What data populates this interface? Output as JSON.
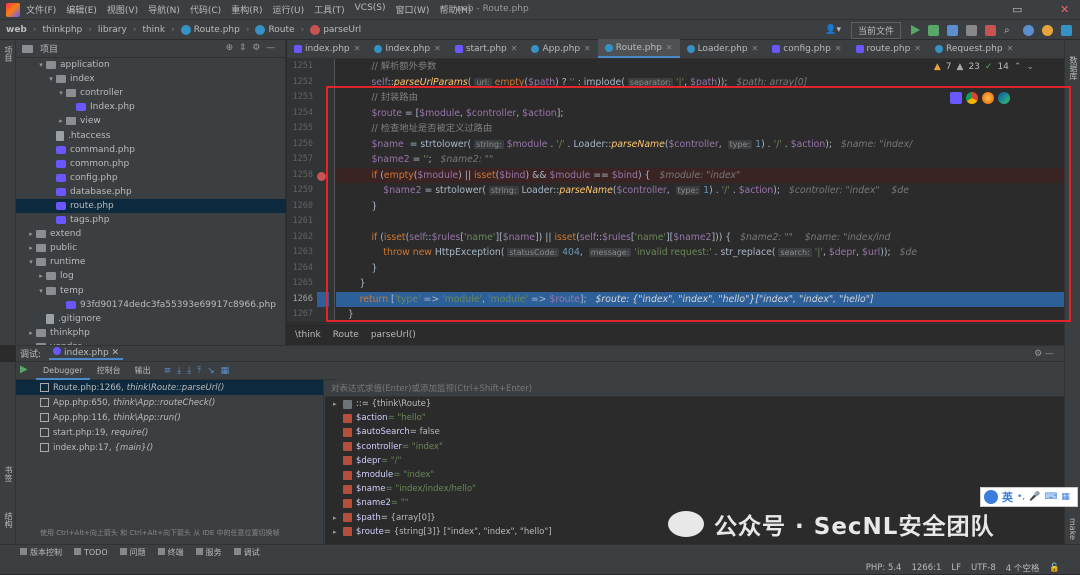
{
  "menubar": {
    "items": [
      "文件(F)",
      "编辑(E)",
      "视图(V)",
      "导航(N)",
      "代码(C)",
      "重构(R)",
      "运行(U)",
      "工具(T)",
      "VCS(S)",
      "窗口(W)",
      "帮助(H)"
    ],
    "title": "web - Route.php"
  },
  "navbar": {
    "crumbs": [
      "web",
      "thinkphp",
      "library",
      "think",
      "Route.php",
      "Route",
      "parseUrl"
    ],
    "run_config": "当前文件"
  },
  "project": {
    "header": "项目",
    "tree": [
      {
        "label": "application",
        "indent": 3,
        "arrow": "v",
        "icon": "folder"
      },
      {
        "label": "index",
        "indent": 4,
        "arrow": "v",
        "icon": "folder"
      },
      {
        "label": "controller",
        "indent": 5,
        "arrow": "v",
        "icon": "folder"
      },
      {
        "label": "Index.php",
        "indent": 6,
        "arrow": "",
        "icon": "php"
      },
      {
        "label": "view",
        "indent": 5,
        "arrow": ">",
        "icon": "folder"
      },
      {
        "label": ".htaccess",
        "indent": 4,
        "arrow": "",
        "icon": "file"
      },
      {
        "label": "command.php",
        "indent": 4,
        "arrow": "",
        "icon": "php"
      },
      {
        "label": "common.php",
        "indent": 4,
        "arrow": "",
        "icon": "php"
      },
      {
        "label": "config.php",
        "indent": 4,
        "arrow": "",
        "icon": "php"
      },
      {
        "label": "database.php",
        "indent": 4,
        "arrow": "",
        "icon": "php"
      },
      {
        "label": "route.php",
        "indent": 4,
        "arrow": "",
        "icon": "php",
        "selected": true
      },
      {
        "label": "tags.php",
        "indent": 4,
        "arrow": "",
        "icon": "php"
      },
      {
        "label": "extend",
        "indent": 2,
        "arrow": ">",
        "icon": "folder"
      },
      {
        "label": "public",
        "indent": 2,
        "arrow": ">",
        "icon": "folder"
      },
      {
        "label": "runtime",
        "indent": 2,
        "arrow": "v",
        "icon": "folder"
      },
      {
        "label": "log",
        "indent": 3,
        "arrow": ">",
        "icon": "folder"
      },
      {
        "label": "temp",
        "indent": 3,
        "arrow": "v",
        "icon": "folder"
      },
      {
        "label": "93fd90174dedc3fa55393e69917c8966.php",
        "indent": 5,
        "arrow": "",
        "icon": "php"
      },
      {
        "label": ".gitignore",
        "indent": 3,
        "arrow": "",
        "icon": "file"
      },
      {
        "label": "thinkphp",
        "indent": 2,
        "arrow": ">",
        "icon": "folder"
      },
      {
        "label": "vendor",
        "indent": 2,
        "arrow": ">",
        "icon": "folder"
      }
    ]
  },
  "tabs": [
    "index.php",
    "Index.php",
    "start.php",
    "App.php",
    "Route.php",
    "Loader.php",
    "config.php",
    "route.php",
    "Request.php"
  ],
  "active_tab": "Route.php",
  "inspection": {
    "warnings": "7",
    "weak": "23",
    "typos": "14"
  },
  "editor": {
    "line_numbers": [
      "1251",
      "1252",
      "1253",
      "1254",
      "1255",
      "1256",
      "1257",
      "1258",
      "1259",
      "1260",
      "1261",
      "1262",
      "1263",
      "1264",
      "1265",
      "1266",
      "1267"
    ],
    "breakpoint_line": "1258",
    "current_line": "1266"
  },
  "code_breadcrumb": [
    "\\think",
    "Route",
    "parseUrl()"
  ],
  "debug": {
    "tab_label": "调试:",
    "session": "index.php",
    "subtabs": [
      "Debugger",
      "控制台",
      "输出"
    ],
    "frames": [
      {
        "file": "Route.php:1266,",
        "call": "think\\Route::parseUrl()"
      },
      {
        "file": "App.php:650,",
        "call": "think\\App::routeCheck()"
      },
      {
        "file": "App.php:116,",
        "call": "think\\App::run()"
      },
      {
        "file": "start.php:19,",
        "call": "require()"
      },
      {
        "file": "index.php:17,",
        "call": "{main}()"
      }
    ],
    "frame_hint": "使用 Ctrl+Alt+向上箭头 和 Ctrl+Alt+向下箭头 从 IDE 中的任意位置切换帧",
    "eval_placeholder": "对表达式求值(Enter)或添加监视(Ctrl+Shift+Enter)",
    "variables": [
      {
        "name": "::",
        "value": "= {think\\Route}",
        "kind": "plain"
      },
      {
        "name": "$action",
        "value": " = \"hello\"",
        "kind": "str"
      },
      {
        "name": "$autoSearch",
        "value": " = false",
        "kind": "plain"
      },
      {
        "name": "$controller",
        "value": " = \"index\"",
        "kind": "str"
      },
      {
        "name": "$depr",
        "value": " = \"/\"",
        "kind": "str"
      },
      {
        "name": "$module",
        "value": " = \"index\"",
        "kind": "str"
      },
      {
        "name": "$name",
        "value": " = \"index/index/hello\"",
        "kind": "str"
      },
      {
        "name": "$name2",
        "value": " = \"\"",
        "kind": "str"
      },
      {
        "name": "$path",
        "value": " = {array[0]}",
        "kind": "plain"
      },
      {
        "name": "$route",
        "value": " = {string[3]} [\"index\", \"index\", \"hello\"]",
        "kind": "plain"
      }
    ]
  },
  "statusbar": {
    "tools": [
      "版本控制",
      "TODO",
      "问题",
      "终端",
      "服务",
      "调试"
    ],
    "right": [
      "PHP: 5.4",
      "1266:1",
      "LF",
      "UTF-8",
      "4 个空格"
    ]
  },
  "watermark": {
    "text": "公众号 · SecNL安全团队"
  },
  "ime": {
    "lang": "英"
  },
  "side_labels": {
    "left_top": "项目",
    "left_bottom1": "书签",
    "left_bottom2": "结构",
    "right_top": "数据库",
    "right_bottom": "make"
  }
}
